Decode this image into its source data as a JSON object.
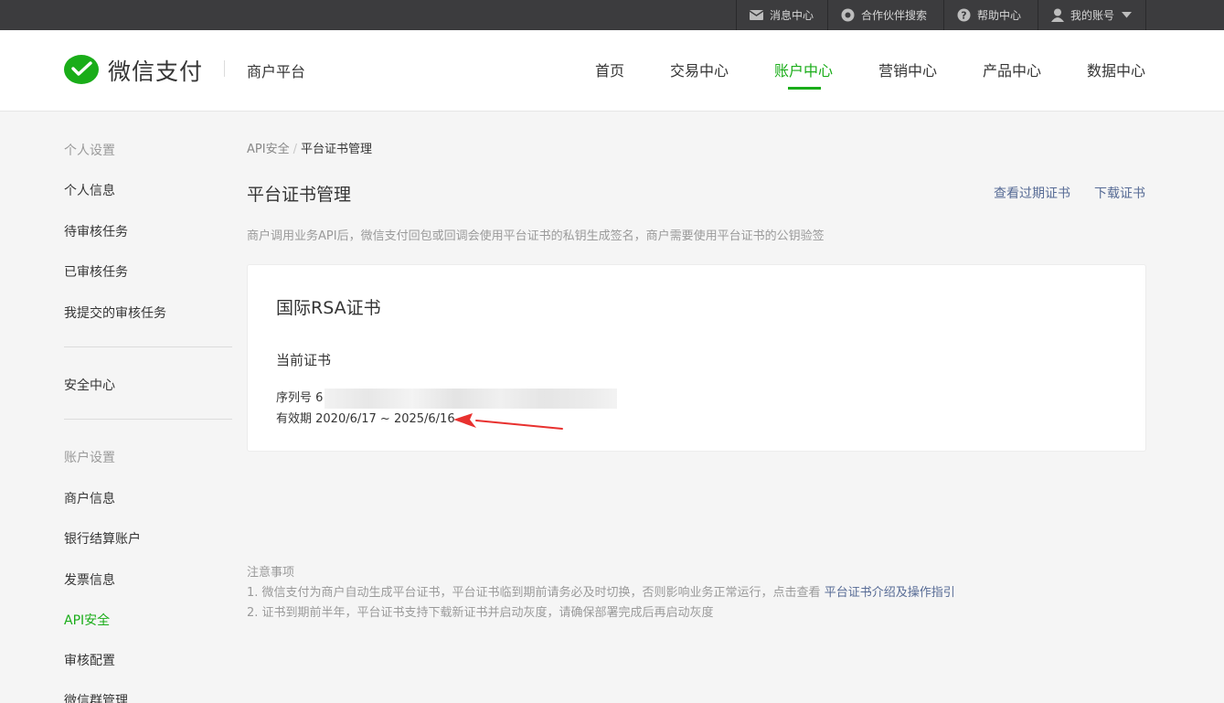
{
  "topbar": {
    "messages": "消息中心",
    "partner_search": "合作伙伴搜索",
    "help": "帮助中心",
    "account": "我的账号"
  },
  "header": {
    "brand": "微信支付",
    "platform": "商户平台",
    "nav": [
      "首页",
      "交易中心",
      "账户中心",
      "营销中心",
      "产品中心",
      "数据中心"
    ],
    "active_nav": "账户中心"
  },
  "sidebar": {
    "group_personal": "个人设置",
    "personal_items": [
      "个人信息",
      "待审核任务",
      "已审核任务",
      "我提交的审核任务"
    ],
    "security_center": "安全中心",
    "group_account": "账户设置",
    "account_items": [
      "商户信息",
      "银行结算账户",
      "发票信息",
      "API安全",
      "审核配置",
      "微信群管理"
    ],
    "active_item": "API安全"
  },
  "main": {
    "breadcrumb_parent": "API安全",
    "breadcrumb_sep": "/",
    "breadcrumb_current": "平台证书管理",
    "title": "平台证书管理",
    "link_expired": "查看过期证书",
    "link_download": "下载证书",
    "description": "商户调用业务API后，微信支付回包或回调会使用平台证书的私钥生成签名，商户需要使用平台证书的公钥验签"
  },
  "card": {
    "title": "国际RSA证书",
    "subtitle": "当前证书",
    "serial_label": "序列号 6",
    "validity": "有效期 2020/6/17 ~ 2025/6/16"
  },
  "notes": {
    "heading": "注意事项",
    "line1_text": "1. 微信支付为商户自动生成平台证书，平台证书临到期前请务必及时切换，否则影响业务正常运行，点击查看",
    "line1_link": "平台证书介绍及操作指引",
    "line2": "2. 证书到期前半年，平台证书支持下载新证书并启动灰度，请确保部署完成后再启动灰度"
  },
  "colors": {
    "accent_green": "#1aad19",
    "link_blue": "#576b95",
    "annotation_arrow": "#e8312f"
  }
}
